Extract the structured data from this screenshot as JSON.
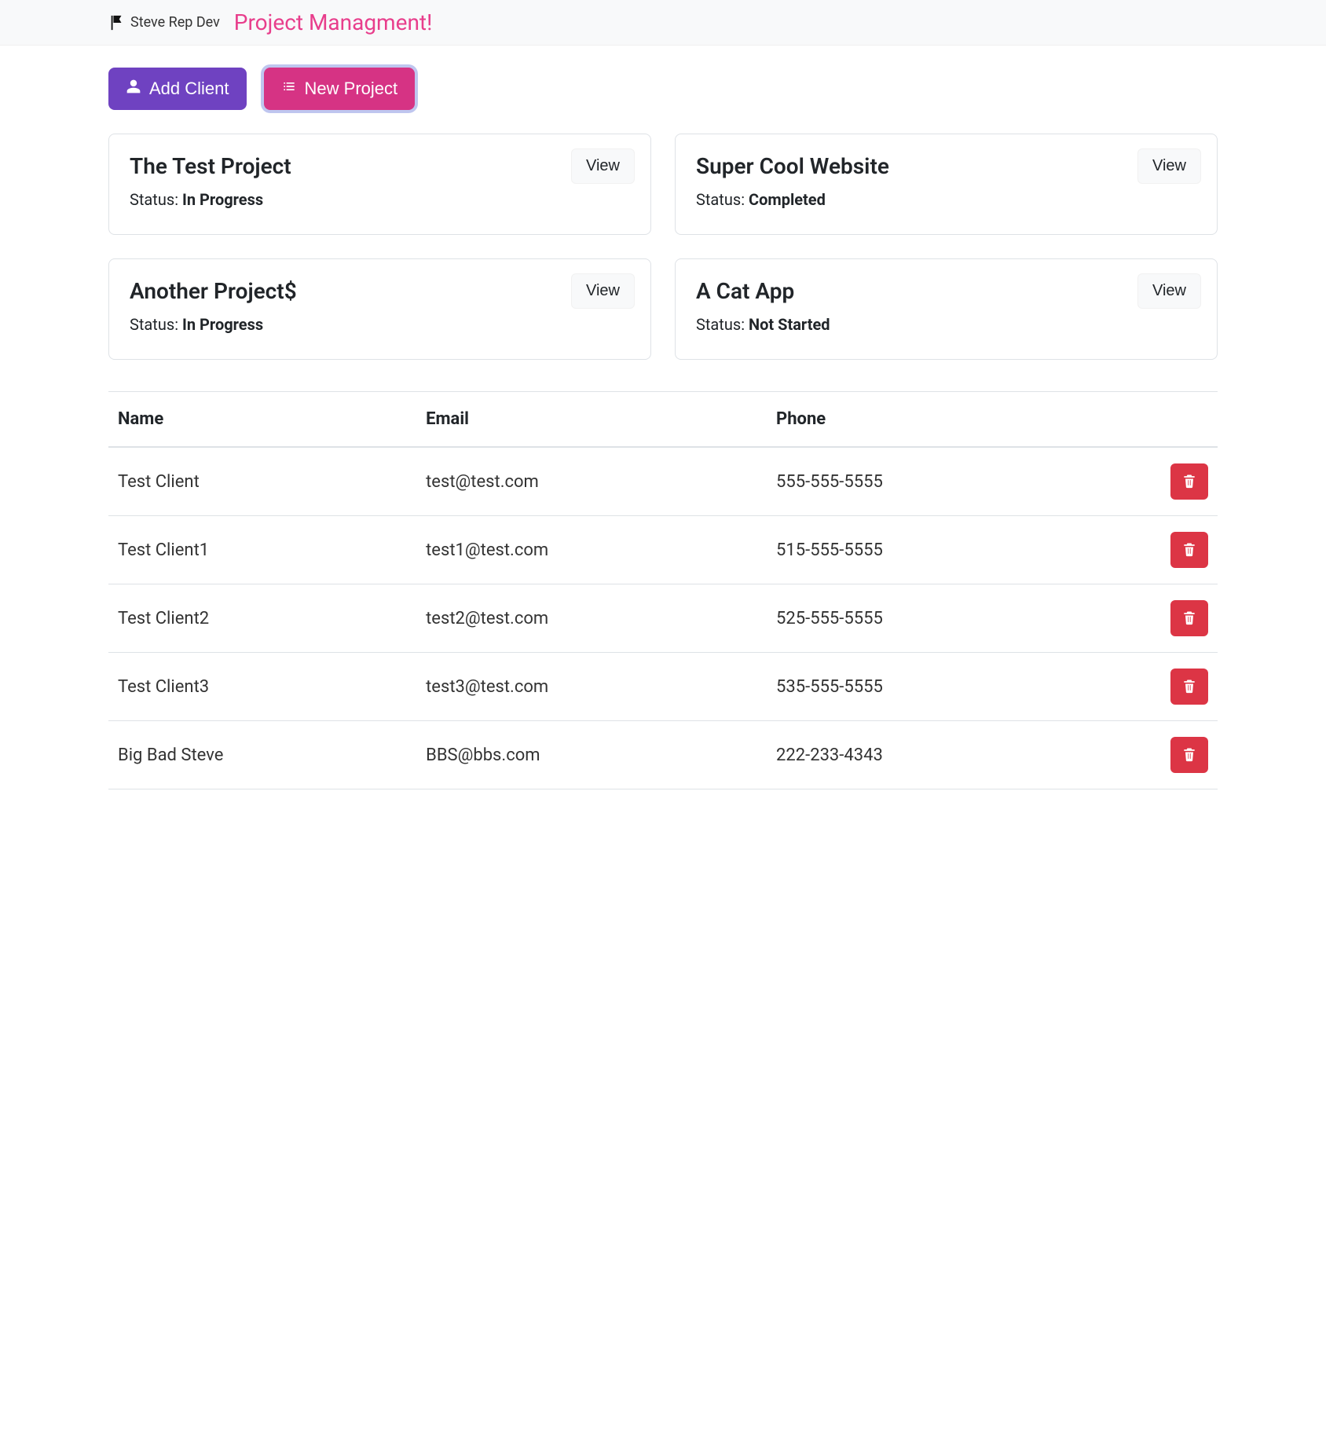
{
  "navbar": {
    "brand_text": "Steve Rep Dev",
    "brand_title": "Project Managment!"
  },
  "actions": {
    "add_client_label": "Add Client",
    "new_project_label": "New Project"
  },
  "status_prefix": "Status: ",
  "view_label": "View",
  "projects": [
    {
      "title": "The Test Project",
      "status": "In Progress"
    },
    {
      "title": "Super Cool Website",
      "status": "Completed"
    },
    {
      "title": "Another Project$",
      "status": "In Progress"
    },
    {
      "title": "A Cat App",
      "status": "Not Started"
    }
  ],
  "clients": {
    "headers": {
      "name": "Name",
      "email": "Email",
      "phone": "Phone"
    },
    "rows": [
      {
        "name": "Test Client",
        "email": "test@test.com",
        "phone": "555-555-5555"
      },
      {
        "name": "Test Client1",
        "email": "test1@test.com",
        "phone": "515-555-5555"
      },
      {
        "name": "Test Client2",
        "email": "test2@test.com",
        "phone": "525-555-5555"
      },
      {
        "name": "Test Client3",
        "email": "test3@test.com",
        "phone": "535-555-5555"
      },
      {
        "name": "Big Bad Steve",
        "email": "BBS@bbs.com",
        "phone": "222-233-4343"
      }
    ]
  }
}
